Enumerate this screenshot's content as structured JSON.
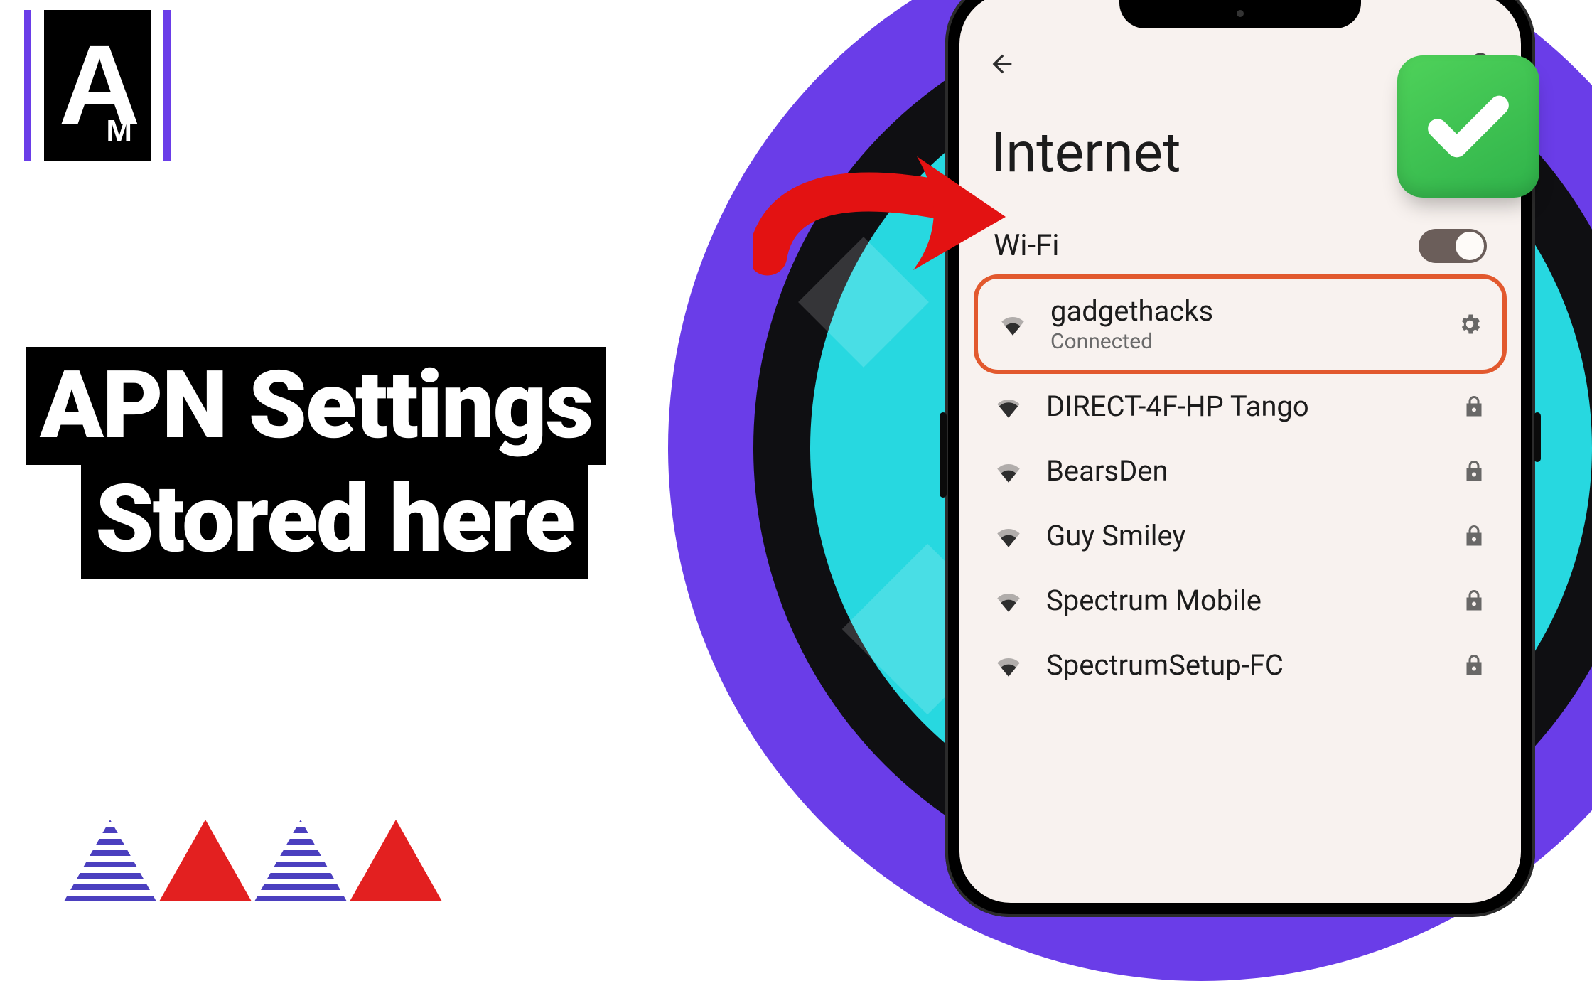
{
  "headline": {
    "line1": "APN Settings",
    "line2": "Stored here"
  },
  "phone": {
    "title": "Internet",
    "wifi_label": "Wi-Fi",
    "networks": [
      {
        "ssid": "gadgethacks",
        "status": "Connected",
        "highlight": true,
        "trailing": "gear"
      },
      {
        "ssid": "DIRECT-4F-HP Tango",
        "status": "",
        "highlight": false,
        "trailing": "lock"
      },
      {
        "ssid": "BearsDen",
        "status": "",
        "highlight": false,
        "trailing": "lock"
      },
      {
        "ssid": "Guy Smiley",
        "status": "",
        "highlight": false,
        "trailing": "lock"
      },
      {
        "ssid": "Spectrum Mobile",
        "status": "",
        "highlight": false,
        "trailing": "lock"
      },
      {
        "ssid": "SpectrumSetup-FC",
        "status": "",
        "highlight": false,
        "trailing": "lock"
      }
    ]
  }
}
